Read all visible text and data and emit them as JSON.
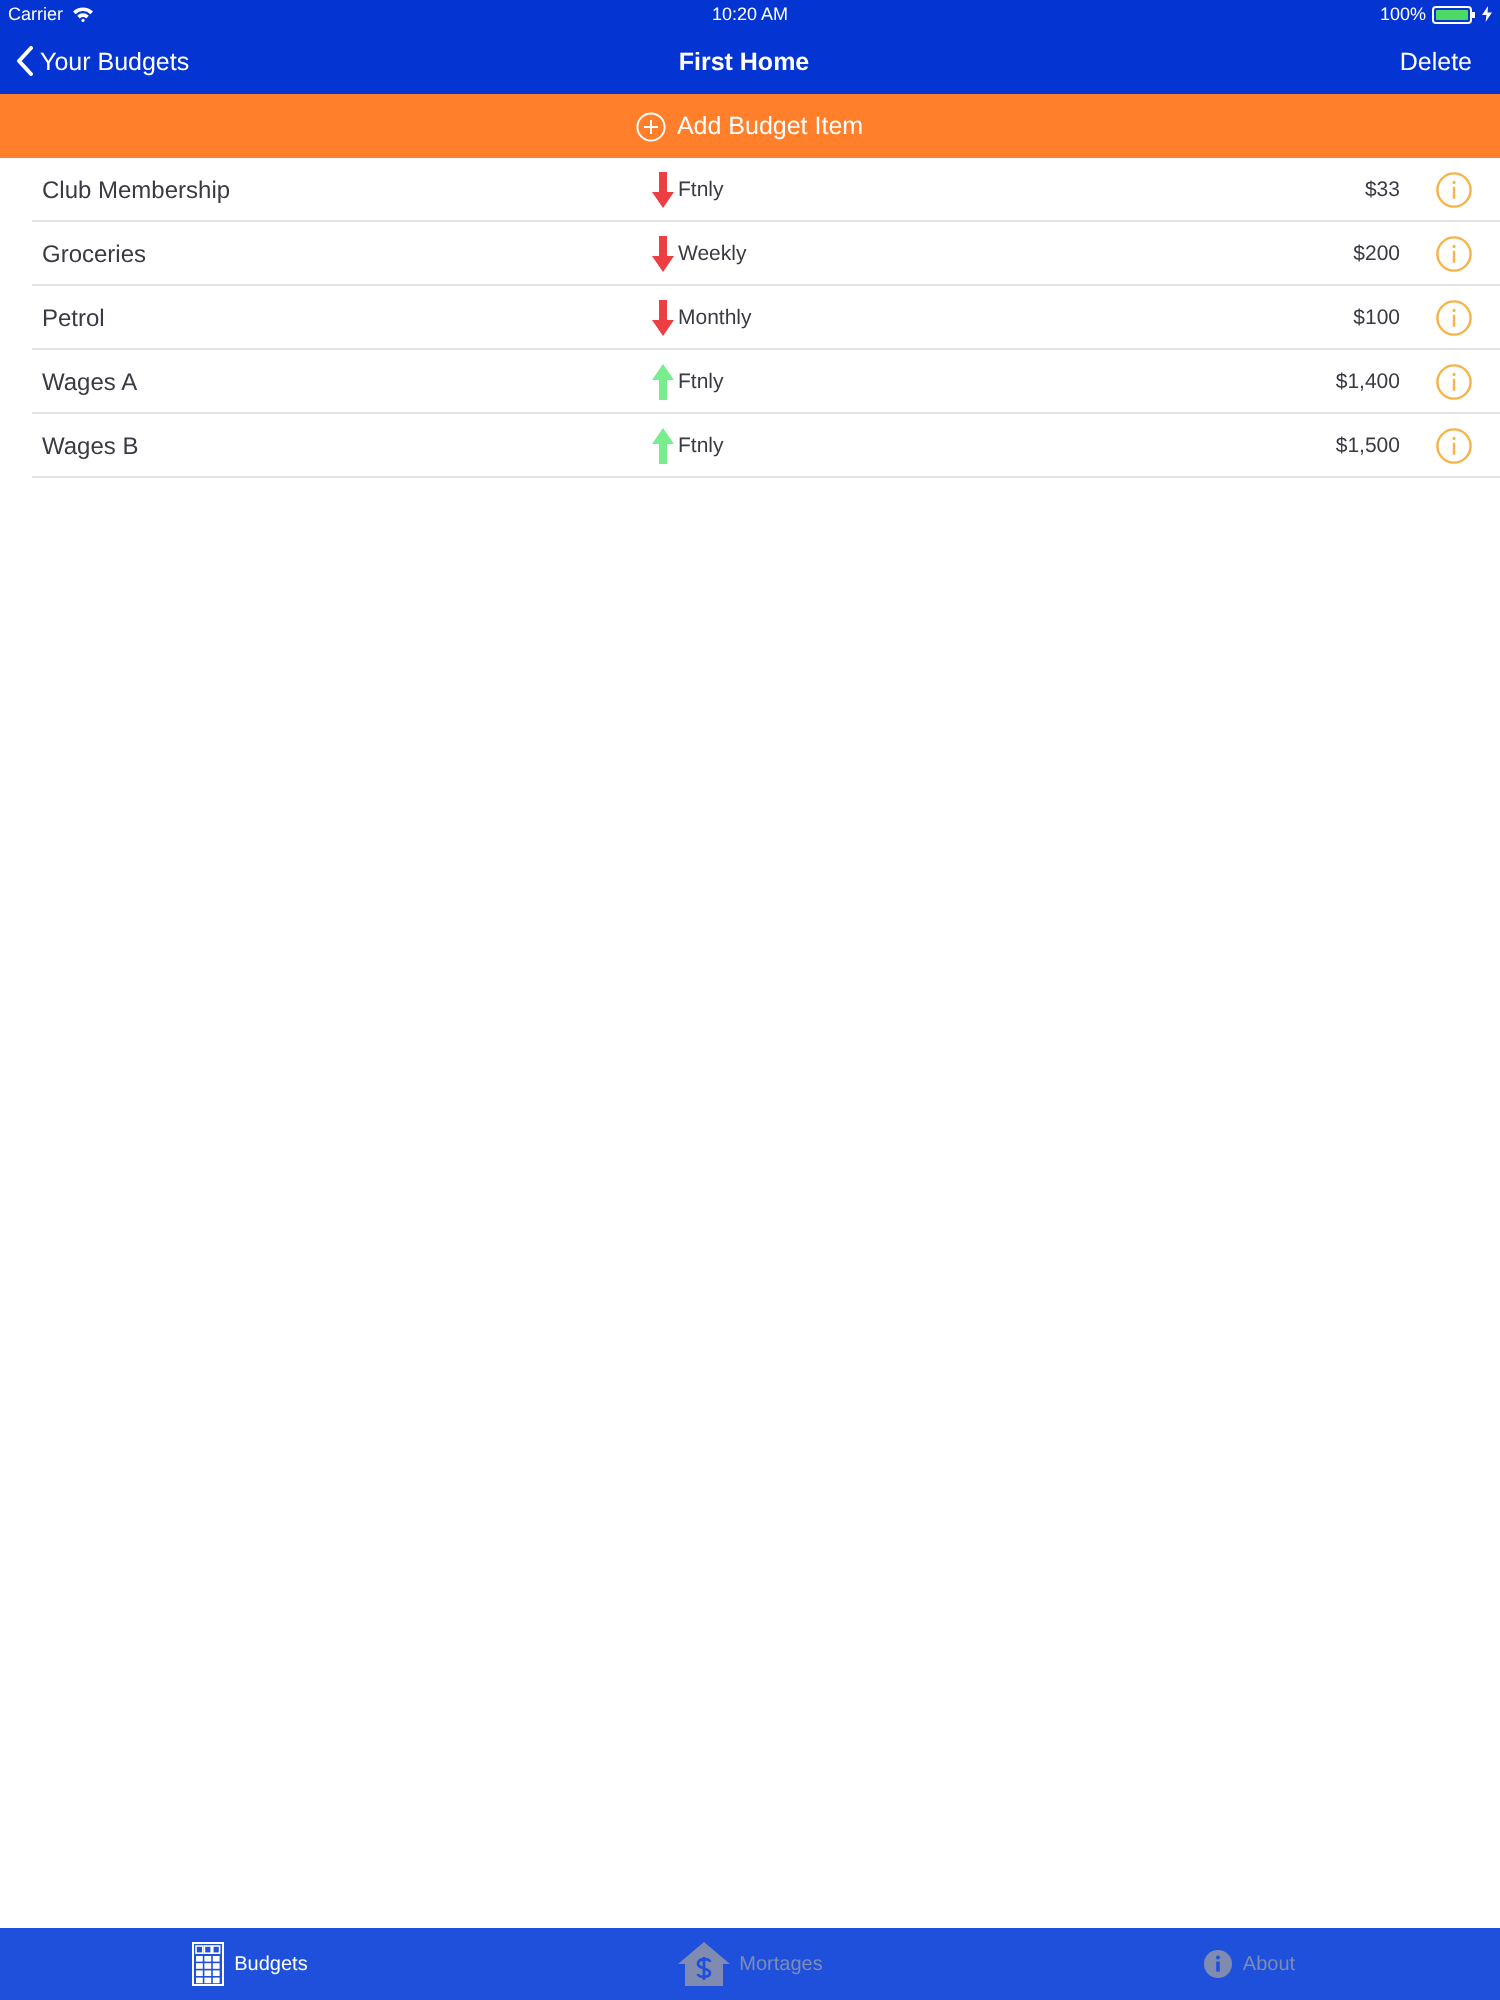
{
  "status_bar": {
    "carrier": "Carrier",
    "time": "10:20 AM",
    "battery": "100%"
  },
  "nav_bar": {
    "back": "Your Budgets",
    "title": "First Home",
    "action": "Delete"
  },
  "add_button": {
    "label": "Add Budget Item"
  },
  "items": [
    {
      "name": "Club Membership",
      "kind": "expense",
      "frequency": "Ftnly",
      "amount": "$33"
    },
    {
      "name": "Groceries",
      "kind": "expense",
      "frequency": "Weekly",
      "amount": "$200"
    },
    {
      "name": "Petrol",
      "kind": "expense",
      "frequency": "Monthly",
      "amount": "$100"
    },
    {
      "name": "Wages A",
      "kind": "income",
      "frequency": "Ftnly",
      "amount": "$1,400"
    },
    {
      "name": "Wages B",
      "kind": "income",
      "frequency": "Ftnly",
      "amount": "$1,500"
    }
  ],
  "tab_bar": [
    {
      "label": "Budgets",
      "kind": "grid",
      "selected": true
    },
    {
      "label": "Mortages",
      "kind": "house",
      "selected": false
    },
    {
      "label": "About",
      "kind": "info",
      "selected": false
    }
  ]
}
